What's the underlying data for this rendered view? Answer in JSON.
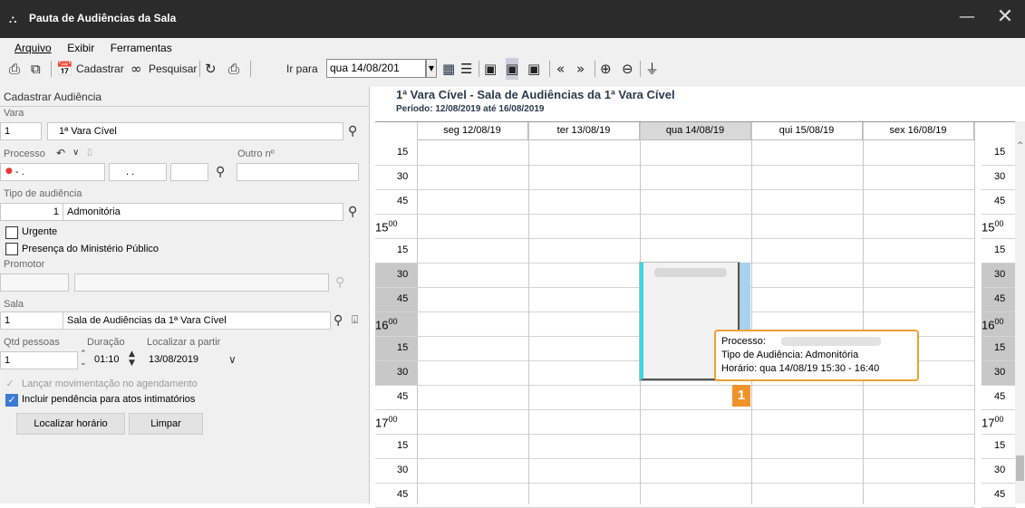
{
  "window": {
    "title": "Pauta de Audiências da Sala",
    "minimize_glyph": "—",
    "close_glyph": "✕",
    "icon": "court-icon"
  },
  "menu": [
    "Arquivo",
    "Exibir",
    "Ferramentas"
  ],
  "toolbar": {
    "cadastrar_label": "Cadastrar",
    "pesquisar_label": "Pesquisar",
    "ir_para_label": "Ir para",
    "ir_para_value": "qua 14/08/201"
  },
  "form": {
    "section_title": "Cadastrar Audiência",
    "vara_label": "Vara",
    "vara_code": "1",
    "vara_name": "1ª Vara Cível",
    "processo_label": "Processo",
    "processo_part1": "- .",
    "processo_part2": ". .",
    "outro_label": "Outro nº",
    "tipo_label": "Tipo de audiência",
    "tipo_code": "1",
    "tipo_name": "Admonitória",
    "urgente_label": "Urgente",
    "urgente_checked": false,
    "presenca_label": "Presença do Ministério Público",
    "presenca_checked": false,
    "promotor_label": "Promotor",
    "sala_label": "Sala",
    "sala_code": "1",
    "sala_name": "Sala de Audiências da 1ª Vara Cível",
    "qtd_label": "Qtd pessoas",
    "qtd_value": "1",
    "duracao_label": "Duração",
    "duracao_value": "01:10",
    "localizar_label": "Localizar a partir",
    "localizar_value": "13/08/2019",
    "lancar_label": "Lançar movimentação no agendamento",
    "lancar_checked": true,
    "incluir_label": "Incluir pendência para atos intimatórios",
    "incluir_checked": true,
    "btn_localizar": "Localizar horário",
    "btn_limpar": "Limpar"
  },
  "calendar": {
    "title": "1ª Vara Cível - Sala de Audiências da 1ª Vara Cível",
    "period": "Período: 12/08/2019 até 16/08/2019",
    "days": [
      "seg 12/08/19",
      "ter 13/08/19",
      "qua 14/08/19",
      "qui 15/08/19",
      "sex 16/08/19"
    ],
    "selected_day_index": 2,
    "slots": [
      {
        "label": "15",
        "hour": false
      },
      {
        "label": "30",
        "hour": false
      },
      {
        "label": "45",
        "hour": false
      },
      {
        "label": "15",
        "sup": "00",
        "hour": true
      },
      {
        "label": "15",
        "hour": false
      },
      {
        "label": "30",
        "hour": false
      },
      {
        "label": "45",
        "hour": false
      },
      {
        "label": "16",
        "sup": "00",
        "hour": true
      },
      {
        "label": "15",
        "hour": false
      },
      {
        "label": "30",
        "hour": false
      },
      {
        "label": "45",
        "hour": false
      },
      {
        "label": "17",
        "sup": "00",
        "hour": true
      },
      {
        "label": "15",
        "hour": false
      },
      {
        "label": "30",
        "hour": false
      },
      {
        "label": "45",
        "hour": false
      }
    ],
    "shaded_slot_indices": [
      5,
      6,
      7,
      8,
      9
    ]
  },
  "tooltip": {
    "processo": "Processo:",
    "tipo": "Tipo de Audiência: Admonitória",
    "horario": "Horário: qua 14/08/19 15:30 - 16:40"
  },
  "badge": "1"
}
